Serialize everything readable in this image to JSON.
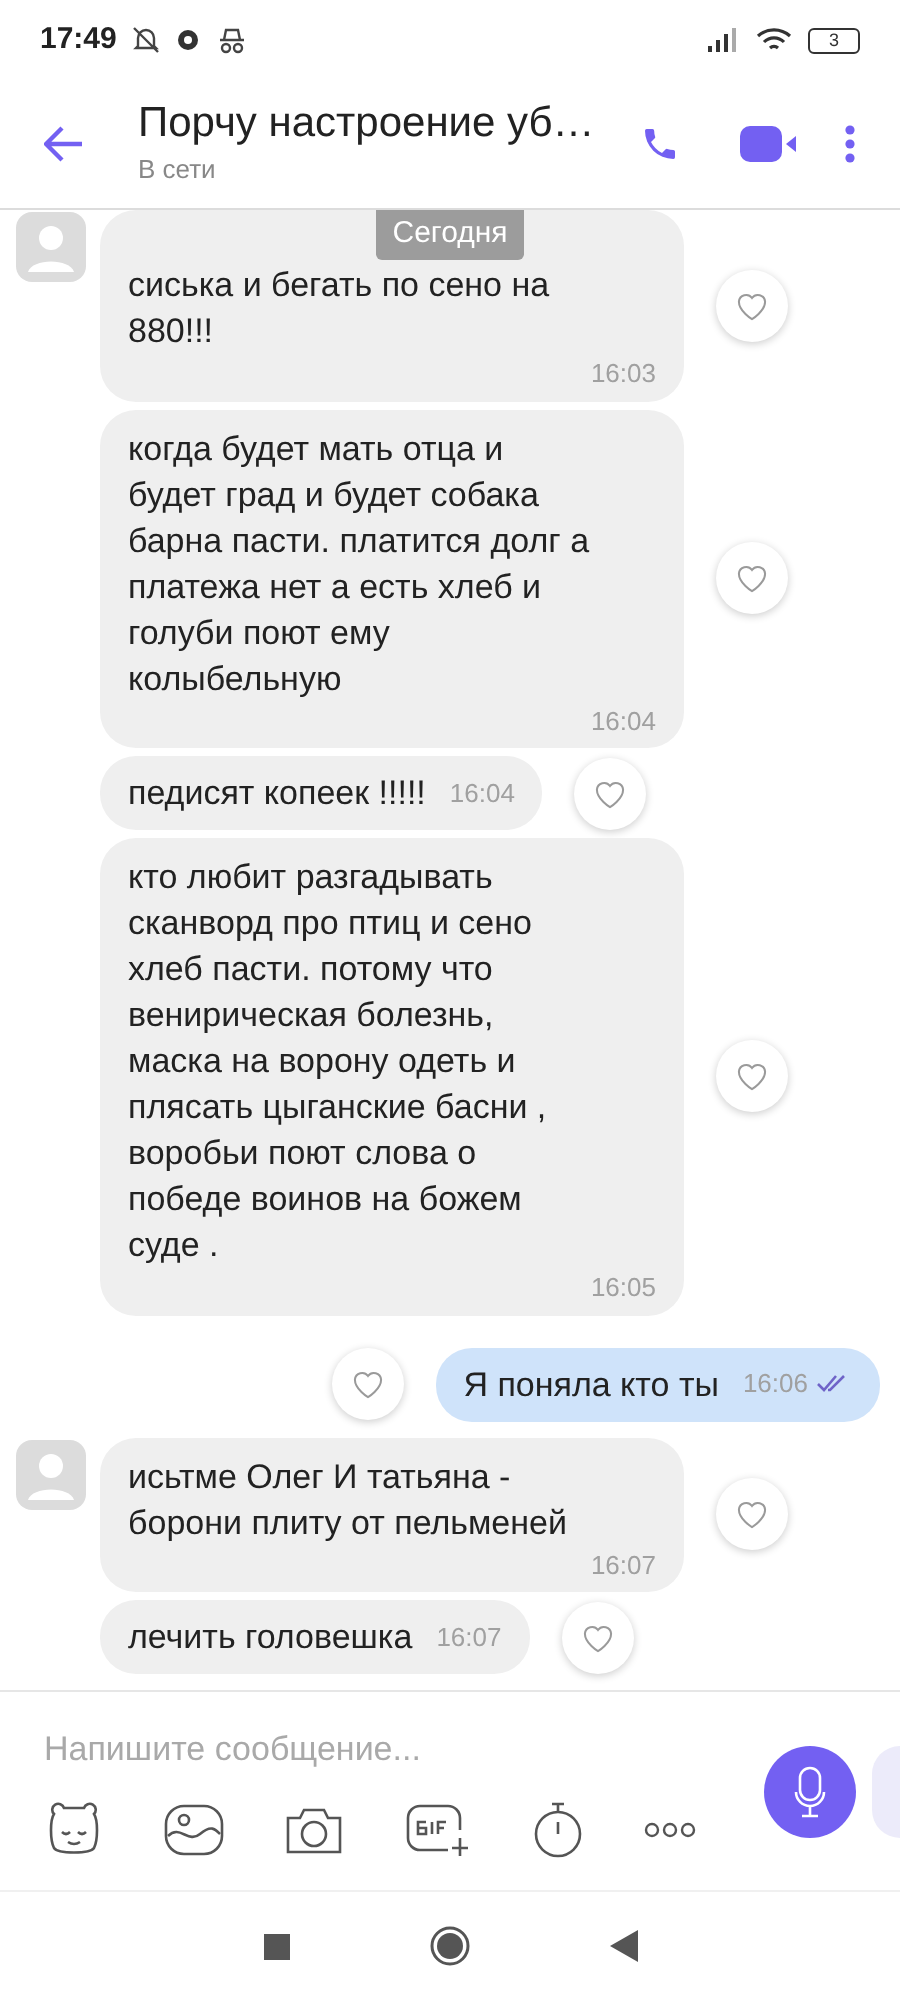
{
  "status_bar": {
    "time": "17:49",
    "battery": "3"
  },
  "header": {
    "title": "Порчу настроение уб…",
    "subtitle": "В сети"
  },
  "date_badge": "Сегодня",
  "messages": [
    {
      "kind": "incoming",
      "avatar": true,
      "lines": [
        "сиська и бегать по сено на",
        "880!!!"
      ],
      "time": "16:03",
      "inline_time": false
    },
    {
      "kind": "incoming",
      "avatar": false,
      "lines": [
        "когда будет мать отца и",
        "будет град и будет собака",
        "барна пасти. платится долг а",
        "платежа нет а есть хлеб и",
        "голуби поют ему",
        "колыбельную"
      ],
      "time": "16:04",
      "inline_time": false
    },
    {
      "kind": "incoming",
      "avatar": false,
      "lines": [
        "педисят копеек !!!!!"
      ],
      "time": "16:04",
      "inline_time": true
    },
    {
      "kind": "incoming",
      "avatar": false,
      "lines": [
        "кто любит разгадывать",
        "сканворд про птиц и сено",
        "хлеб пасти. потому что",
        "венирическая болезнь,",
        "маска на ворону одеть и",
        "плясать цыганские басни ,",
        "воробьи поют слова о",
        "победе воинов на божем",
        "суде ."
      ],
      "time": "16:05",
      "inline_time": false
    },
    {
      "kind": "outgoing",
      "avatar": false,
      "lines": [
        "Я поняла кто ты"
      ],
      "time": "16:06",
      "inline_time": true,
      "read": true
    },
    {
      "kind": "incoming",
      "avatar": true,
      "lines": [
        "исьтме Олег И татьяна -",
        "борони плиту от пельменей"
      ],
      "time": "16:07",
      "inline_time": false
    },
    {
      "kind": "incoming",
      "avatar": false,
      "lines": [
        "лечить головешка"
      ],
      "time": "16:07",
      "inline_time": true
    }
  ],
  "composer": {
    "placeholder": "Напишите сообщение..."
  }
}
